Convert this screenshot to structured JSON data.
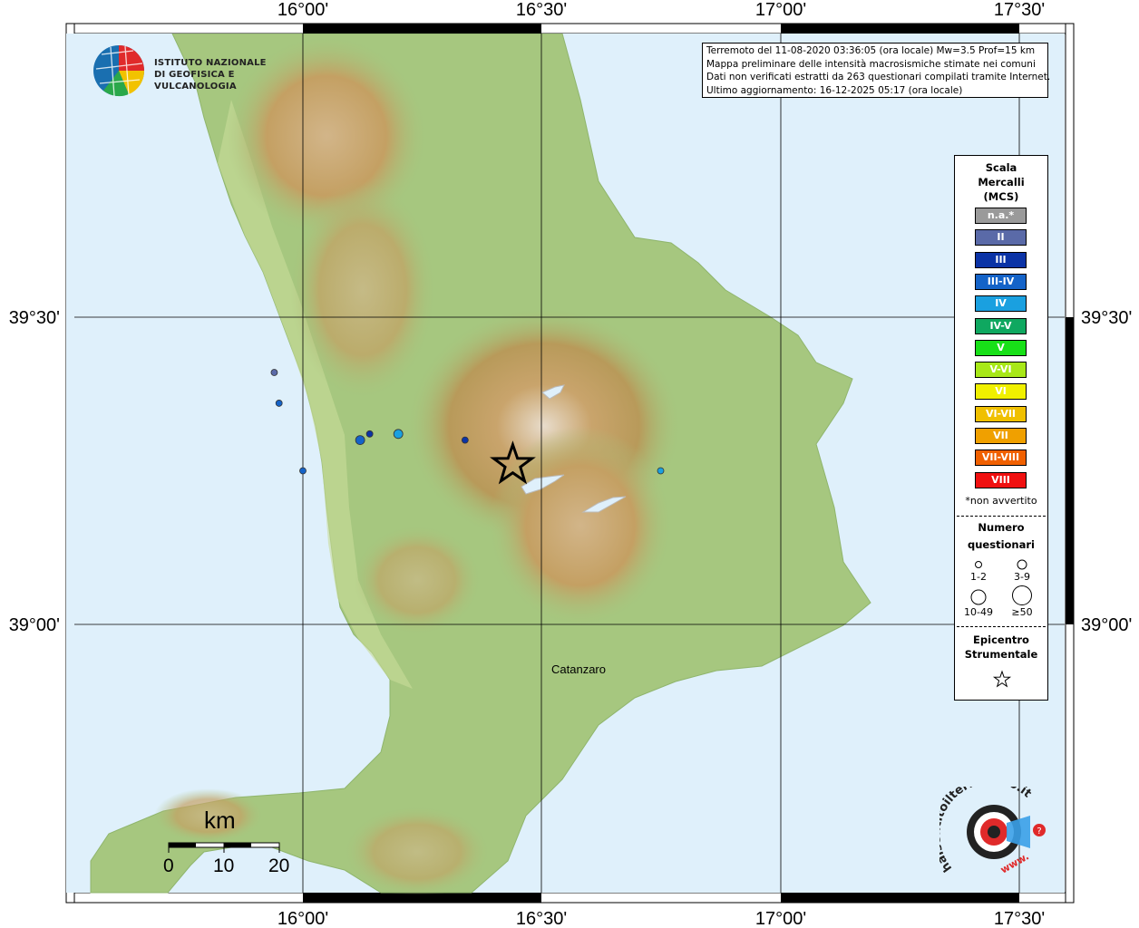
{
  "title": {
    "lines": [
      "Terremoto del 11-08-2020 03:36:05 (ora locale) Mw=3.5 Prof=15 km",
      "Mappa preliminare delle intensità macrosismiche stimate nei comuni",
      "Dati non verificati estratti da 263 questionari compilati tramite Internet.",
      "Ultimo aggiornamento: 16-12-2025 05:17 (ora locale)"
    ]
  },
  "logo": {
    "line1": "ISTITUTO NAZIONALE",
    "line2": "DI GEOFISICA E VULCANOLOGIA"
  },
  "axes": {
    "top_ticks": [
      "16°00'",
      "16°30'",
      "17°00'",
      "17°30'"
    ],
    "bottom_ticks": [
      "16°00'",
      "16°30'",
      "17°00'",
      "17°30'"
    ],
    "left_ticks": [
      "39°30'",
      "39°00'"
    ],
    "right_ticks": [
      "39°30'",
      "39°00'"
    ]
  },
  "city": {
    "name": "Catanzaro"
  },
  "legend": {
    "title_lines": [
      "Scala",
      "Mercalli",
      "(MCS)"
    ],
    "items": [
      {
        "label": "n.a.*",
        "color": "#9a9a9a"
      },
      {
        "label": "II",
        "color": "#5a6aa8"
      },
      {
        "label": "III",
        "color": "#0b33a6"
      },
      {
        "label": "III-IV",
        "color": "#1463c8"
      },
      {
        "label": "IV",
        "color": "#1aa0e0"
      },
      {
        "label": "IV-V",
        "color": "#0fa860"
      },
      {
        "label": "V",
        "color": "#18e018"
      },
      {
        "label": "V-VI",
        "color": "#a8e818"
      },
      {
        "label": "VI",
        "color": "#f0f000"
      },
      {
        "label": "VI-VII",
        "color": "#f0c000"
      },
      {
        "label": "VII",
        "color": "#f0a000"
      },
      {
        "label": "VII-VIII",
        "color": "#f06000"
      },
      {
        "label": "VIII",
        "color": "#f01010"
      }
    ],
    "note": "*non avvertito",
    "questionari_title": [
      "Numero",
      "questionari"
    ],
    "size_labels": [
      "1-2",
      "3-9",
      "10-49",
      "≥50"
    ],
    "epicentre_title": [
      "Epicentro",
      "Strumentale"
    ]
  },
  "scalebar": {
    "unit": "km",
    "labels": [
      "0",
      "10",
      "20"
    ]
  },
  "badge": {
    "text": "haisentitoilterremoto.it",
    "www": "www."
  },
  "epicentre": {
    "lon": 16.44,
    "lat": 39.26
  },
  "observations": [
    {
      "lon": 15.94,
      "lat": 39.41,
      "mcs": "II",
      "n": 1
    },
    {
      "lon": 15.95,
      "lat": 39.36,
      "mcs": "III-IV",
      "n": 1
    },
    {
      "lon": 16.0,
      "lat": 39.25,
      "mcs": "III-IV",
      "n": 2
    },
    {
      "lon": 16.12,
      "lat": 39.3,
      "mcs": "III-IV",
      "n": 3
    },
    {
      "lon": 16.14,
      "lat": 39.31,
      "mcs": "III",
      "n": 2
    },
    {
      "lon": 16.2,
      "lat": 39.31,
      "mcs": "IV",
      "n": 3
    },
    {
      "lon": 16.34,
      "lat": 39.3,
      "mcs": "III",
      "n": 2
    },
    {
      "lon": 16.75,
      "lat": 39.25,
      "mcs": "IV",
      "n": 2
    }
  ]
}
